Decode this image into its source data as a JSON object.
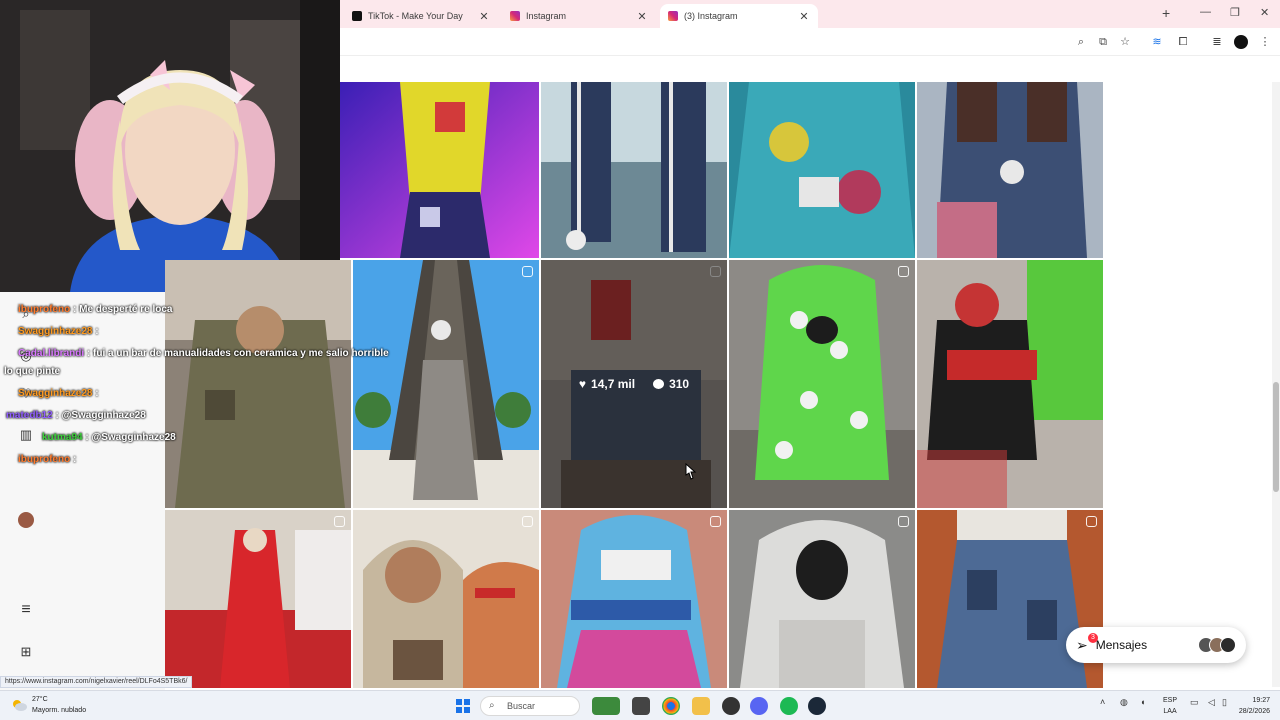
{
  "browser": {
    "tabs": [
      {
        "label": "TikTok - Make Your Day",
        "icon": "tiktok-icon",
        "active": false
      },
      {
        "label": "Instagram",
        "icon": "instagram-icon",
        "active": false
      },
      {
        "label": "(3) Instagram",
        "icon": "instagram-icon",
        "active": true
      }
    ],
    "status_url": "https://www.instagram.com/nigelxavier/reel/DLFo4S5TBk6/"
  },
  "grid": {
    "hover_post": {
      "likes": "14,7 mil",
      "comments": "310"
    }
  },
  "messages": {
    "label": "Mensajes",
    "badge": "3"
  },
  "chat": {
    "lines": [
      {
        "user": "ibuprofeno",
        "text": ": Me desperté re loca",
        "color": "#ff7b2d"
      },
      {
        "user": "Swagginhaze28",
        "text": ":",
        "color": "#ff9a1f"
      },
      {
        "user": "Cadal.librandi",
        "text": ": fui a un bar de manualidades con ceramica y me salio horrible",
        "color": "#d977ff"
      },
      {
        "user": "",
        "text": "lo que pinte",
        "color": "#ffffff"
      },
      {
        "user": "Swagginhaze28",
        "text": ":",
        "color": "#ff9a1f"
      },
      {
        "user": "matedb12",
        "text": ": @Swagginhaze28",
        "color": "#8f5bff"
      },
      {
        "user": "kutma94",
        "text": ": @Swagginhaze28",
        "color": "#3dd13d"
      },
      {
        "user": "ibuprofeno",
        "text": ":",
        "color": "#ff7b2d"
      }
    ]
  },
  "taskbar": {
    "weather_temp": "27°C",
    "weather_desc": "Mayorm. nublado",
    "search_placeholder": "Buscar",
    "lang_1": "ESP",
    "lang_2": "LAA",
    "time": "19:27",
    "date": "28/2/2026"
  },
  "colors": {
    "tab_strip": "#fce8ec",
    "instagram_badge": "#ff3040",
    "taskbar": "#eef2f8"
  }
}
